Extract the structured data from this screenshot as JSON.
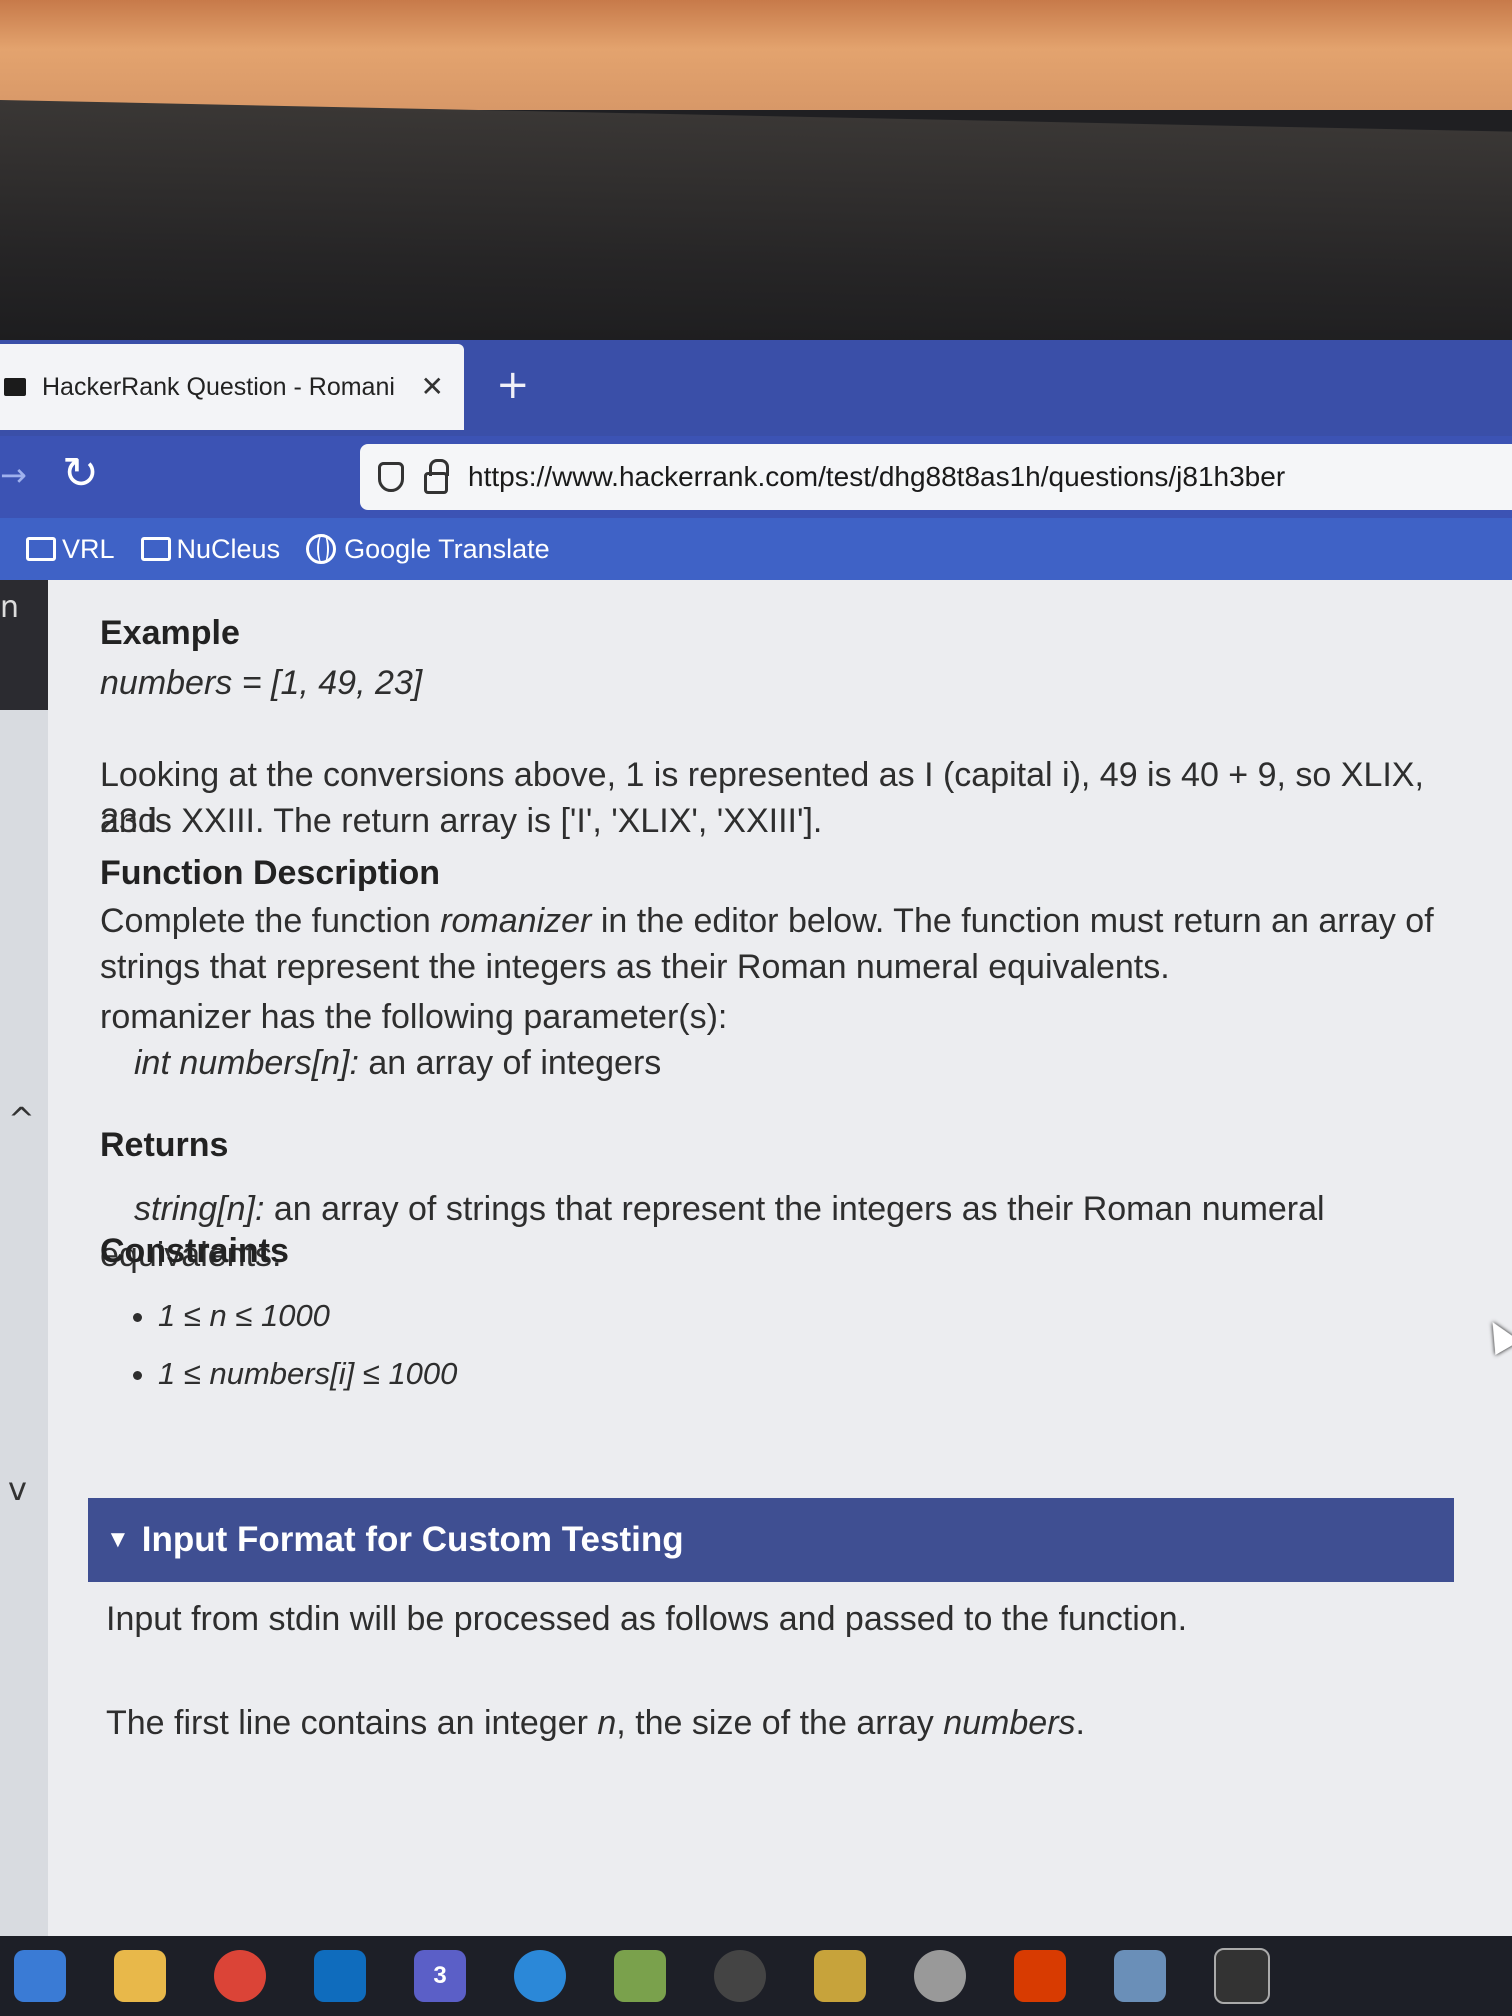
{
  "browser": {
    "tab_title": "HackerRank Question - Romani",
    "tab_close": "✕",
    "new_tab": "+",
    "back": "→",
    "reload": "↻",
    "url": "https://www.hackerrank.com/test/dhg88t8as1h/questions/j81h3ber",
    "bookmarks": [
      "VRL",
      "NuCleus",
      "Google Translate"
    ]
  },
  "left_rail": {
    "letter": "n",
    "collapse": "^",
    "expand": "v"
  },
  "question": {
    "example_heading": "Example",
    "example_line": "numbers = [1, 49, 23]",
    "explanation_line1": "Looking at the conversions above, 1 is represented as I (capital i), 49 is 40 + 9, so XLIX, and",
    "explanation_line2": "23 is XXIII. The return array is ['I', 'XLIX', 'XXIII'].",
    "function_heading": "Function Description",
    "function_desc_pre": "Complete the function ",
    "function_name": "romanizer",
    "function_desc_post": " in the editor below. The function must return an array of strings that represent the integers as their Roman numeral equivalents.",
    "params_intro": "romanizer has the following parameter(s):",
    "param_name": "int numbers[n]:",
    "param_desc": " an array of integers",
    "returns_heading": "Returns",
    "returns_type": "string[n]:",
    "returns_desc": " an array of strings that represent the integers as their Roman numeral equivalents.",
    "constraints_heading": "Constraints",
    "constraints": [
      "1 ≤ n ≤ 1000",
      "1 ≤ numbers[i] ≤ 1000"
    ],
    "input_format_heading": "Input Format for Custom Testing",
    "input_format_line": "Input from stdin will be processed as follows and passed to the function.",
    "first_line_pre": "The first line contains an integer ",
    "first_line_var": "n",
    "first_line_mid": ", the size of the array ",
    "first_line_arr": "numbers",
    "first_line_end": "."
  },
  "taskbar": {
    "teams_badge": "3",
    "icons": [
      "task-view-icon",
      "file-explorer-icon",
      "chrome-icon",
      "outlook-icon",
      "teams-icon",
      "edge-icon",
      "notepad-icon",
      "ue-icon",
      "mail-icon",
      "paint-icon",
      "acrobat-icon",
      "network-icon",
      "terminal-icon",
      "remote-icon"
    ],
    "colors": [
      "#3a7bd5",
      "#e8b84a",
      "#db4437",
      "#0f6cbd",
      "#5b5fc7",
      "#2b88d8",
      "#7aa14c",
      "#444",
      "#c7a33b",
      "#999",
      "#d83b01",
      "#6a8fb8",
      "#333",
      "#6a8fb8"
    ]
  }
}
